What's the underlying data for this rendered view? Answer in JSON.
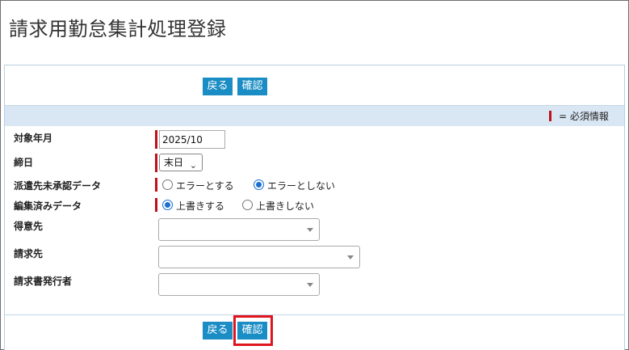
{
  "page": {
    "title": "請求用勤怠集計処理登録"
  },
  "buttons": {
    "back": "戻る",
    "confirm": "確認"
  },
  "legend": {
    "required": "= 必須情報"
  },
  "form": {
    "target_month": {
      "label": "対象年月",
      "value": "2025/10"
    },
    "closing_day": {
      "label": "締日",
      "value": "末日"
    },
    "unapproved": {
      "label": "派遣先未承認データ",
      "options": [
        "エラーとする",
        "エラーとしない"
      ],
      "selected": "エラーとしない"
    },
    "edited": {
      "label": "編集済みデータ",
      "options": [
        "上書きする",
        "上書きしない"
      ],
      "selected": "上書きする"
    },
    "customer": {
      "label": "得意先",
      "value": ""
    },
    "billing_to": {
      "label": "請求先",
      "value": ""
    },
    "issuer": {
      "label": "請求書発行者",
      "value": ""
    }
  },
  "colors": {
    "button": "#1a8dc5",
    "required_mark": "#c0101a",
    "legend_bar": "#d9e7f4",
    "highlight": "#e0141e"
  }
}
